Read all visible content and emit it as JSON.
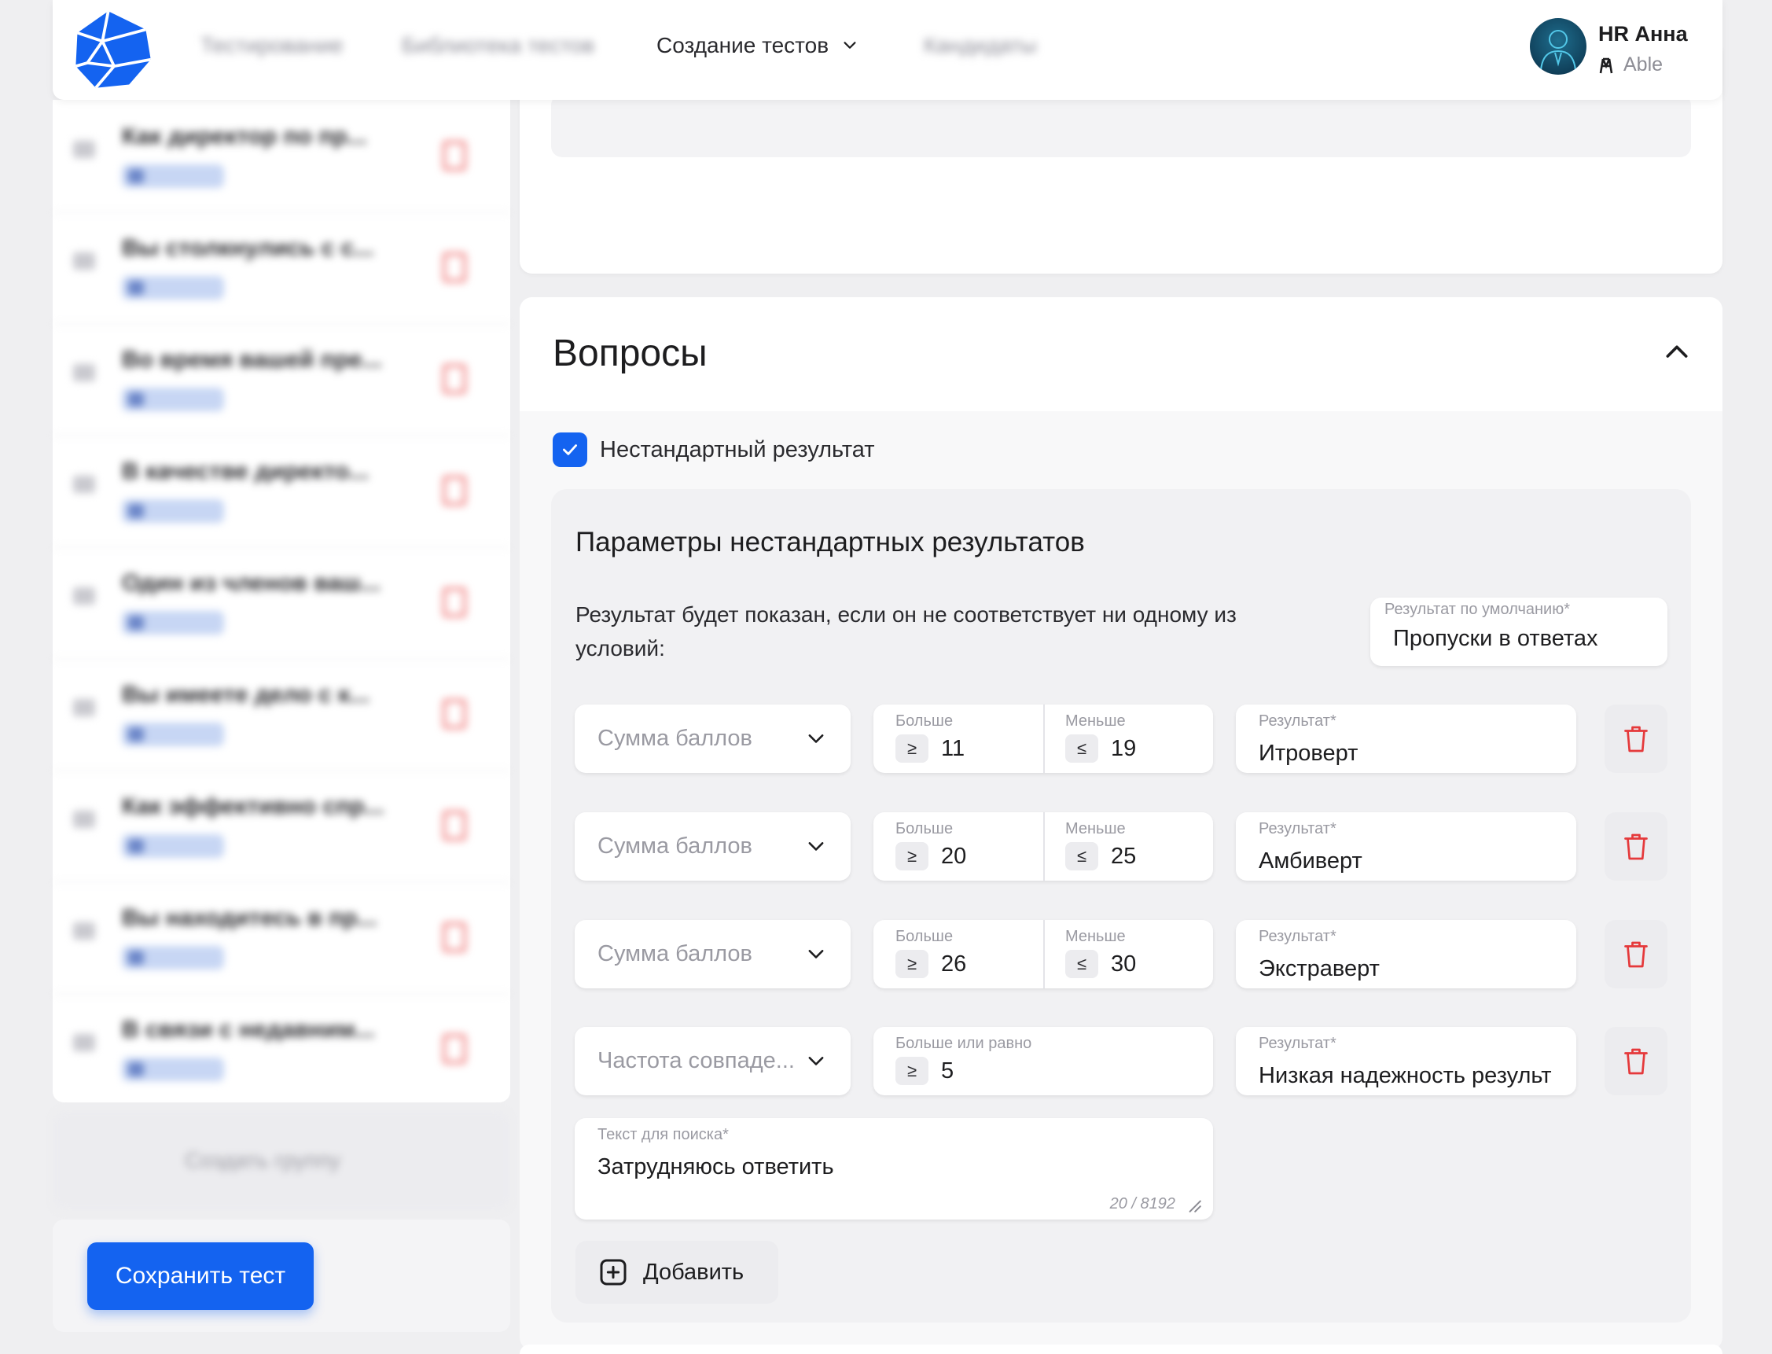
{
  "header": {
    "nav": [
      {
        "label": "Тестирование",
        "blurred": true
      },
      {
        "label": "Библиотека тестов",
        "blurred": true
      },
      {
        "label": "Создание тестов",
        "blurred": false
      },
      {
        "label": "Кандидаты",
        "blurred": true
      }
    ],
    "user": {
      "name": "HR Анна",
      "org": "Able"
    }
  },
  "sidebar": {
    "questions": [
      {
        "title": "Как директор по пр..."
      },
      {
        "title": "Вы столкнулись с с..."
      },
      {
        "title": "Во время вашей пре..."
      },
      {
        "title": "В качестве директо..."
      },
      {
        "title": "Один из членов ваш..."
      },
      {
        "title": "Вы имеете дело с к..."
      },
      {
        "title": "Как эффективно спр..."
      },
      {
        "title": "Вы находитесь в пр..."
      },
      {
        "title": "В связи с недавним..."
      }
    ],
    "create_group_label": "Создать группу",
    "save_label": "Сохранить тест"
  },
  "main": {
    "section_title": "Вопросы",
    "custom_result_checkbox": {
      "label": "Нестандартный результат",
      "checked": true
    },
    "params": {
      "title": "Параметры нестандартных результатов",
      "description": "Результат будет показан, если он не соответствует ни одному из условий:",
      "default_result": {
        "label": "Результат по умолчанию*",
        "value": "Пропуски в ответах"
      },
      "rules": [
        {
          "type": "Сумма баллов",
          "more_label": "Больше",
          "less_label": "Меньше",
          "gte": "≥",
          "lte": "≤",
          "min": "11",
          "max": "19",
          "result_label": "Результат*",
          "result": "Итроверт"
        },
        {
          "type": "Сумма баллов",
          "more_label": "Больше",
          "less_label": "Меньше",
          "gte": "≥",
          "lte": "≤",
          "min": "20",
          "max": "25",
          "result_label": "Результат*",
          "result": "Амбиверт"
        },
        {
          "type": "Сумма баллов",
          "more_label": "Больше",
          "less_label": "Меньше",
          "gte": "≥",
          "lte": "≤",
          "min": "26",
          "max": "30",
          "result_label": "Результат*",
          "result": "Экстраверт"
        }
      ],
      "frequency_rule": {
        "type": "Частота совпаде...",
        "gte_label": "Больше или равно",
        "gte": "≥",
        "value": "5",
        "result_label": "Результат*",
        "result": "Низкая надежность результ",
        "search_label": "Текст для поиска*",
        "search_value": "Затрудняюсь ответить",
        "counter": "20 / 8192"
      },
      "add_label": "Добавить"
    }
  },
  "colors": {
    "accent": "#1463f0",
    "danger": "#e5393b",
    "background": "#efeff1"
  }
}
